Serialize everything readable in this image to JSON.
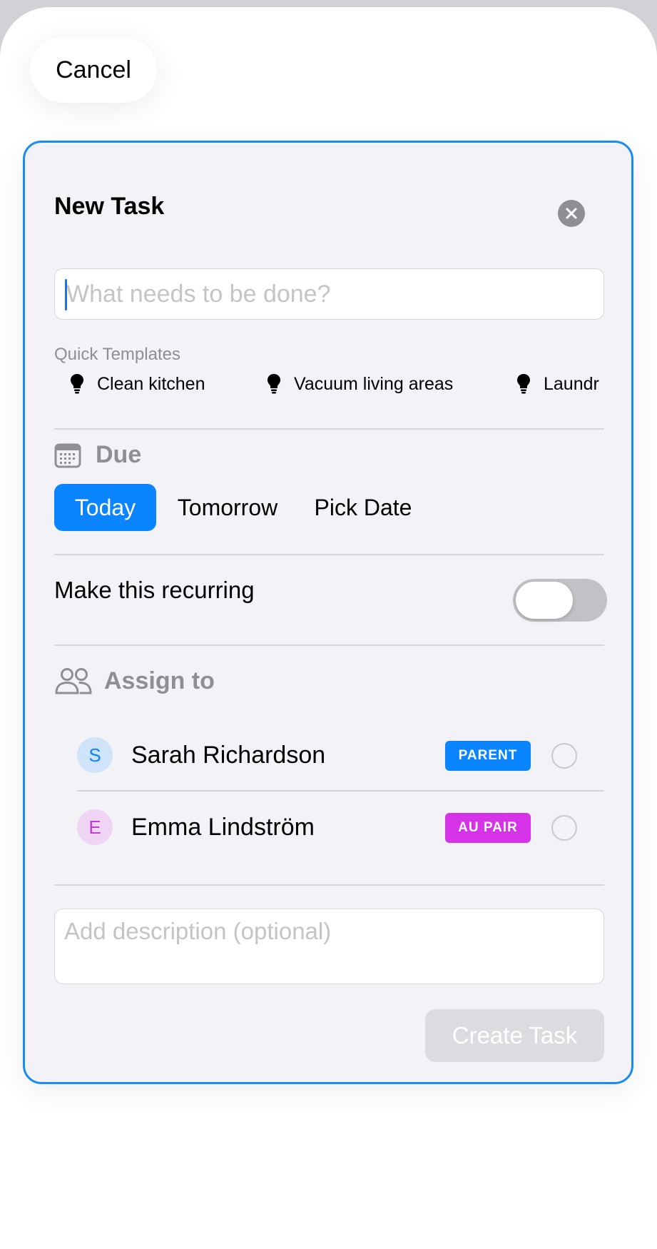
{
  "header": {
    "cancel_label": "Cancel"
  },
  "card": {
    "title": "New Task",
    "title_input_placeholder": "What needs to be done?",
    "templates_label": "Quick Templates",
    "templates": [
      "Clean kitchen",
      "Vacuum living areas",
      "Laundr"
    ],
    "due": {
      "label": "Due",
      "options": [
        "Today",
        "Tomorrow",
        "Pick Date"
      ],
      "selected": "Today"
    },
    "recurring": {
      "label": "Make this recurring",
      "enabled": false
    },
    "assign": {
      "label": "Assign to",
      "members": [
        {
          "initial": "S",
          "name": "Sarah Richardson",
          "role": "PARENT",
          "role_color": "#0a84ff",
          "avatar_bg": "#cfe3f9",
          "avatar_fg": "#0a84ff",
          "selected": false
        },
        {
          "initial": "E",
          "name": "Emma Lindström",
          "role": "AU PAIR",
          "role_color": "#d633e8",
          "avatar_bg": "#f0d4f4",
          "avatar_fg": "#c23ad9",
          "selected": false
        }
      ]
    },
    "description_placeholder": "Add description (optional)",
    "create_label": "Create Task"
  },
  "colors": {
    "accent": "#0a84ff",
    "card_border": "#1a8bf0"
  }
}
